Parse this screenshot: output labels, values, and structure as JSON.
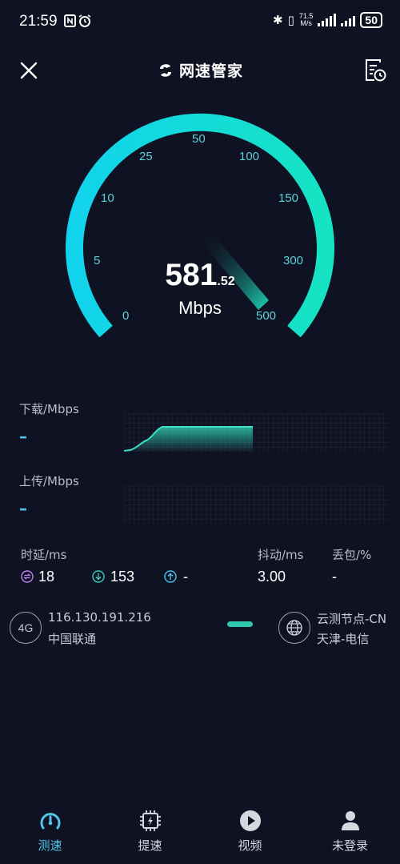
{
  "status_bar": {
    "time": "21:59",
    "network_speed_value": "71.5",
    "network_speed_unit": "M/s",
    "battery": "50"
  },
  "header": {
    "title": "网速管家"
  },
  "gauge": {
    "ticks": [
      "0",
      "5",
      "10",
      "25",
      "50",
      "100",
      "150",
      "300",
      "500"
    ],
    "speed_int": "581",
    "speed_dec": ".52",
    "unit": "Mbps",
    "arc_color_start": "#12d3ec",
    "arc_color_end": "#16e3c3"
  },
  "download": {
    "label": "下载/Mbps",
    "value": "–"
  },
  "upload": {
    "label": "上传/Mbps",
    "value": "–"
  },
  "latency": {
    "label": "时延/ms",
    "idle": "18",
    "down": "153",
    "up": "-"
  },
  "jitter": {
    "label": "抖动/ms",
    "value": "3.00"
  },
  "packet_loss": {
    "label": "丢包/%",
    "value": "-"
  },
  "client": {
    "badge": "4G",
    "ip": "116.130.191.216",
    "isp": "中国联通"
  },
  "server": {
    "name": "云测节点-CN",
    "location": "天津-电信"
  },
  "nav": {
    "items": [
      {
        "label": "测速",
        "icon": "speedometer-icon",
        "active": true
      },
      {
        "label": "提速",
        "icon": "chip-boost-icon",
        "active": false
      },
      {
        "label": "视频",
        "icon": "play-icon",
        "active": false
      },
      {
        "label": "未登录",
        "icon": "user-icon",
        "active": false
      }
    ]
  },
  "colors": {
    "background": "#0f1222",
    "accent": "#4fc5ea",
    "graph": "#2fc7ae"
  }
}
